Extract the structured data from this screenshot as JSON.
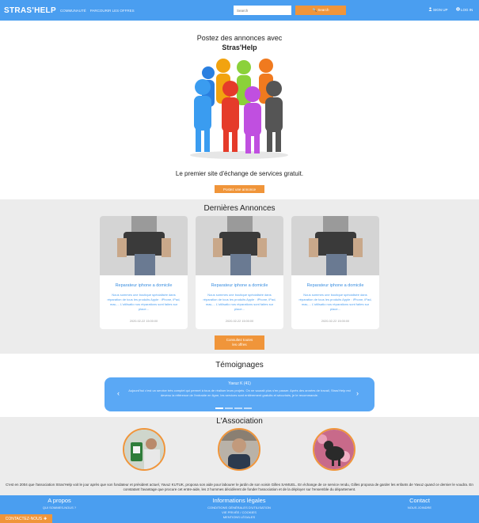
{
  "navbar": {
    "brand": "STRAS'HELP",
    "links": [
      "COMMUNAUTÉ",
      "PARCOURIR LES OFFRES"
    ],
    "search_placeholder": "Search",
    "search_button": "🔍 Search",
    "signup": "SIGN UP",
    "login": "LOG IN"
  },
  "hero": {
    "title_line1": "Postez des annonces avec",
    "title_line2": "Stras'Help",
    "tagline": "Le premier site d'échange de services gratuit.",
    "button": "Postez une annonce"
  },
  "annonces": {
    "title": "Dernières Annonces",
    "cards": [
      {
        "title": "Reparateur iphone a domicile",
        "desc": "Nous sommes une boutique spécialisée dans réparation de tous les produits Apple : iPhone, iPad, mac,... L'utilisatio nos réparations sont faites sur place...",
        "date": "2020-02-22 15:00:00"
      },
      {
        "title": "Reparateur iphone a domicile",
        "desc": "Nous sommes une boutique spécialisée dans réparation de tous les produits Apple : iPhone, iPad, mac,... L'utilisatio nos réparations sont faites sur place...",
        "date": "2020-02-22 15:00:00"
      },
      {
        "title": "Reparateur iphone a domicile",
        "desc": "Nous sommes une boutique spécialisée dans réparation de tous les produits Apple : iPhone, iPad, mac,... L'utilisatio nos réparations sont faites sur place...",
        "date": "2020-02-22 15:00:00"
      }
    ],
    "more_line1": "Consultez toutes",
    "more_line2": "les offres"
  },
  "temoignages": {
    "title": "Témoignages",
    "name": "Yavuz K (41)",
    "text": "Aujourd'hui c'est un service très complet qui permet à tous de réaliser leurs projets. On ne saurait plus s'en passer. Après des années de travail, Stras'Help est devenu la référence de l'entraide en ligne, les services sont entièrement gratuits et sécurisés, je le recommande."
  },
  "association": {
    "title": "L'Association",
    "text": "C'est en 2004 que l'association Stras'Help voit le jour après que son fondateur et président actuel, Yavuz KUTUK, proposa son aide pour labourer le jardin de son voisin Gilles SAMUEL. En échange de ce service rendu, Gilles proposa de garder les enfants de Yavuz quand ce dernier le voudra. En constatant l'avantage que procure cet entre-aide, les 2 hommes décidèrent de fonder l'association et de la déployer sur l'ensemble du département."
  },
  "footer": {
    "apropos_title": "A propos",
    "apropos_link": "QUI SOMMES-NOUS ?",
    "info_title": "Informations légales",
    "info_links": [
      "CONDITIONS GÉNÉRALES D'UTILISATION",
      "VIE PRIVÉE / COOKIES",
      "MENTIONS LÉGALES"
    ],
    "contact_title": "Contact",
    "contact_link": "NOUS JOINDRE",
    "contact_button": "CONTACTEZ-NOUS"
  },
  "colors": {
    "primary": "#4a9ef0",
    "accent": "#f0953a",
    "section_gray": "#ececec"
  }
}
